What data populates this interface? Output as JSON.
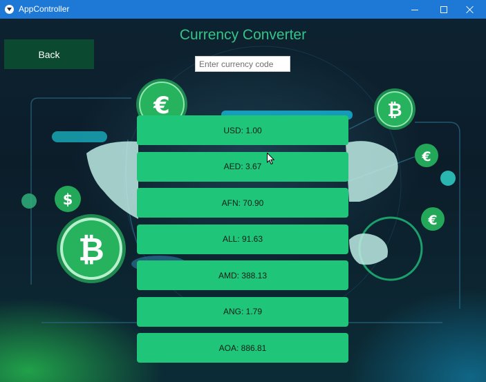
{
  "window": {
    "title": "AppController"
  },
  "page": {
    "title": "Currency Converter",
    "back_label": "Back",
    "search": {
      "placeholder": "Enter currency code",
      "value": ""
    }
  },
  "rates": [
    {
      "label": "USD: 1.00"
    },
    {
      "label": "AED: 3.67"
    },
    {
      "label": "AFN: 70.90"
    },
    {
      "label": "ALL: 91.63"
    },
    {
      "label": "AMD: 388.13"
    },
    {
      "label": "ANG: 1.79"
    },
    {
      "label": "AOA: 886.81"
    }
  ],
  "background": {
    "icons": [
      "euro-coin-icon",
      "bitcoin-coin-icon",
      "dollar-coin-icon",
      "bitcoin-coin-icon",
      "euro-coin-icon",
      "euro-coin-icon"
    ]
  },
  "colors": {
    "titlebar": "#1e78d6",
    "accent_title": "#33c48a",
    "back_button": "#0b4a30",
    "rate_item": "#1fc67a"
  }
}
